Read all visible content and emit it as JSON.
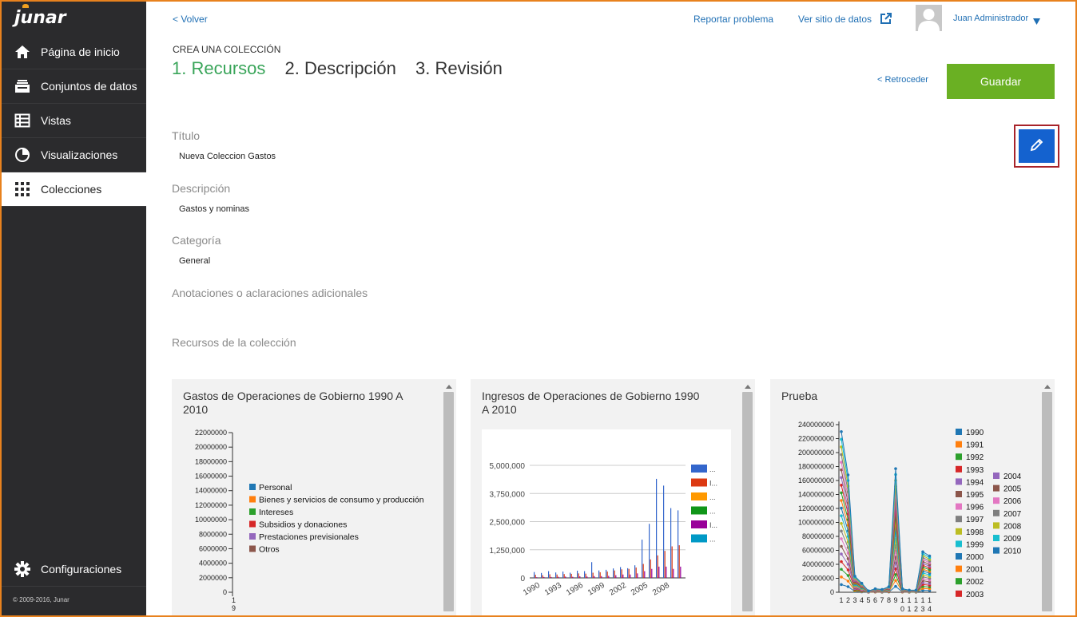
{
  "app": {
    "logo": "junar",
    "copyright": "© 2009-2016, Junar"
  },
  "sidebar": {
    "items": [
      {
        "label": "Página de inicio",
        "icon": "home-icon"
      },
      {
        "label": "Conjuntos de datos",
        "icon": "inbox-icon"
      },
      {
        "label": "Vistas",
        "icon": "table-icon"
      },
      {
        "label": "Visualizaciones",
        "icon": "pie-chart-icon"
      },
      {
        "label": "Colecciones",
        "icon": "grid-icon",
        "active": true
      }
    ],
    "settings_label": "Configuraciones"
  },
  "topbar": {
    "back": "< Volver",
    "report": "Reportar problema",
    "site": "Ver sitio de datos",
    "user": "Juan Administrador"
  },
  "wizard": {
    "heading": "CREA UNA COLECCIÓN",
    "steps": [
      "1. Recursos",
      "2. Descripción",
      "3. Revisión"
    ],
    "back": "< Retroceder",
    "save": "Guardar"
  },
  "form": {
    "title_label": "Título",
    "title_value": "Nueva Coleccion Gastos",
    "description_label": "Descripción",
    "description_value": "Gastos y nominas",
    "category_label": "Categoría",
    "category_value": "General",
    "notes_label": "Anotaciones o aclaraciones adicionales",
    "resources_label": "Recursos de la colección"
  },
  "colors": {
    "accent_green": "#3aa55a",
    "save_green": "#6ab023",
    "edit_blue": "#1462cf",
    "link": "#1f6fb4"
  },
  "chart_data": [
    {
      "type": "bar",
      "title": "Gastos de Operaciones de Gobierno 1990 A 2010",
      "ylim": [
        0,
        22000000
      ],
      "yticks": [
        "22000000",
        "20000000",
        "18000000",
        "16000000",
        "14000000",
        "12000000",
        "10000000",
        "8000000",
        "6000000",
        "4000000",
        "2000000",
        "0"
      ],
      "xticks": [
        "19"
      ],
      "legend": [
        {
          "name": "Personal",
          "color": "#1f77b4"
        },
        {
          "name": "Bienes y servicios de consumo y producción",
          "color": "#ff7f0e"
        },
        {
          "name": "Intereses",
          "color": "#2ca02c"
        },
        {
          "name": "Subsidios y donaciones",
          "color": "#d62728"
        },
        {
          "name": "Prestaciones previsionales",
          "color": "#9467bd"
        },
        {
          "name": "Otros",
          "color": "#8c564b"
        }
      ]
    },
    {
      "type": "bar",
      "title": "Ingresos de Operaciones de Gobierno 1990 A 2010",
      "ylim": [
        0,
        5000000
      ],
      "yticks": [
        "5,000,000",
        "3,750,000",
        "2,500,000",
        "1,250,000",
        "0"
      ],
      "xticks": [
        "1990",
        "1993",
        "1996",
        "1999",
        "2002",
        "2005",
        "2008"
      ],
      "legend_colors": [
        "#3366cc",
        "#dc3912",
        "#ff9900",
        "#109618",
        "#990099",
        "#0099c6"
      ],
      "legend_labels": [
        "...",
        "I...",
        "...",
        "...",
        "I...",
        "..."
      ],
      "series": [
        {
          "color": "#3366cc",
          "values": [
            260000,
            220000,
            300000,
            240000,
            280000,
            230000,
            320000,
            300000,
            700000,
            330000,
            360000,
            420000,
            480000,
            430000,
            560000,
            1700000,
            2400000,
            4400000,
            4100000,
            3100000,
            3000000
          ]
        },
        {
          "color": "#dc3912",
          "values": [
            140000,
            120000,
            160000,
            150000,
            170000,
            180000,
            200000,
            190000,
            230000,
            250000,
            280000,
            330000,
            380000,
            400000,
            460000,
            620000,
            820000,
            1000000,
            1200000,
            1400000,
            1450000
          ]
        },
        {
          "color": "#990099",
          "values": [
            30000,
            40000,
            40000,
            50000,
            60000,
            50000,
            70000,
            60000,
            80000,
            80000,
            90000,
            120000,
            150000,
            150000,
            200000,
            300000,
            400000,
            500000,
            500000,
            400000,
            500000
          ]
        }
      ]
    },
    {
      "type": "line",
      "title": "Prueba",
      "ylim": [
        0,
        240000000
      ],
      "yticks": [
        "240000000",
        "220000000",
        "200000000",
        "180000000",
        "160000000",
        "140000000",
        "120000000",
        "100000000",
        "80000000",
        "60000000",
        "40000000",
        "20000000",
        "0"
      ],
      "xticks": [
        "1",
        "2",
        "3",
        "4",
        "5",
        "6",
        "7",
        "8",
        "9",
        "1 0",
        "1 1",
        "1 2",
        "1 3",
        "1 4"
      ],
      "legend": [
        {
          "name": "1990",
          "color": "#1f77b4"
        },
        {
          "name": "1991",
          "color": "#ff7f0e"
        },
        {
          "name": "1992",
          "color": "#2ca02c"
        },
        {
          "name": "1993",
          "color": "#d62728"
        },
        {
          "name": "1994",
          "color": "#9467bd"
        },
        {
          "name": "1995",
          "color": "#8c564b"
        },
        {
          "name": "1996",
          "color": "#e377c2"
        },
        {
          "name": "1997",
          "color": "#7f7f7f"
        },
        {
          "name": "1998",
          "color": "#bcbd22"
        },
        {
          "name": "1999",
          "color": "#17becf"
        },
        {
          "name": "2000",
          "color": "#1f77b4"
        },
        {
          "name": "2001",
          "color": "#ff7f0e"
        },
        {
          "name": "2002",
          "color": "#2ca02c"
        },
        {
          "name": "2003",
          "color": "#d62728"
        },
        {
          "name": "2004",
          "color": "#9467bd"
        },
        {
          "name": "2005",
          "color": "#8c564b"
        },
        {
          "name": "2006",
          "color": "#e377c2"
        },
        {
          "name": "2007",
          "color": "#7f7f7f"
        },
        {
          "name": "2008",
          "color": "#bcbd22"
        },
        {
          "name": "2009",
          "color": "#17becf"
        },
        {
          "name": "2010",
          "color": "#1f77b4"
        }
      ],
      "series_top": [
        230000000,
        168000000,
        23000000,
        13000000,
        2000000,
        5000000,
        4000000,
        8000000,
        177000000,
        5000000,
        3000000,
        3000000,
        58000000,
        52000000
      ]
    }
  ]
}
